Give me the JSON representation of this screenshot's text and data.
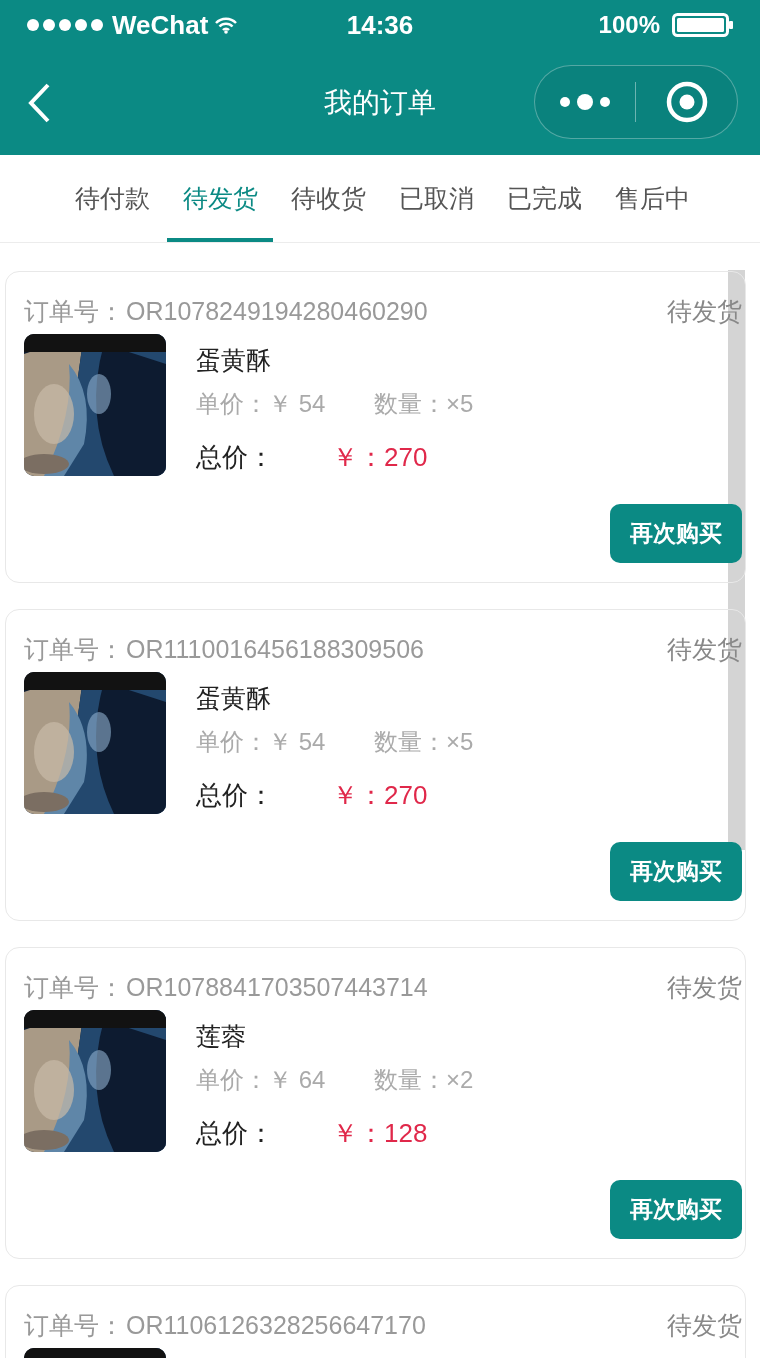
{
  "status_bar": {
    "carrier": "WeChat",
    "time": "14:36",
    "battery": "100%"
  },
  "nav": {
    "title": "我的订单"
  },
  "tabs": [
    {
      "label": "待付款",
      "selected": false
    },
    {
      "label": "待发货",
      "selected": true
    },
    {
      "label": "待收货",
      "selected": false
    },
    {
      "label": "已取消",
      "selected": false
    },
    {
      "label": "已完成",
      "selected": false
    },
    {
      "label": "售后中",
      "selected": false
    }
  ],
  "orders": [
    {
      "order_label": "订单号：",
      "order_no": "OR1078249194280460290",
      "status": "待发货",
      "name": "蛋黄酥",
      "unit_price": "单价：￥ 54",
      "quantity": "数量：×5",
      "total_label": "总价：",
      "total": "￥：270",
      "button": "再次购买"
    },
    {
      "order_label": "订单号：",
      "order_no": "OR1110016456188309506",
      "status": "待发货",
      "name": "蛋黄酥",
      "unit_price": "单价：￥ 54",
      "quantity": "数量：×5",
      "total_label": "总价：",
      "total": "￥：270",
      "button": "再次购买"
    },
    {
      "order_label": "订单号：",
      "order_no": "OR1078841703507443714",
      "status": "待发货",
      "name": "莲蓉",
      "unit_price": "单价：￥ 64",
      "quantity": "数量：×2",
      "total_label": "总价：",
      "total": "￥：128",
      "button": "再次购买"
    },
    {
      "order_label": "订单号：",
      "order_no": "OR1106126328256647170",
      "status": "待发货"
    }
  ]
}
